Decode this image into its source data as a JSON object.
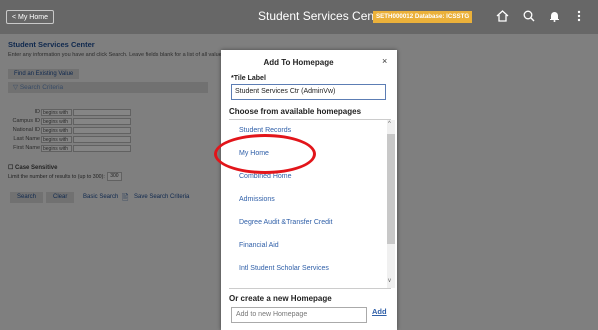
{
  "topbar": {
    "back_label": "< My Home",
    "title": "Student Services Center",
    "db_badge": "SETH000012 Database: ICSSTG"
  },
  "search_page": {
    "title": "Student Services Center",
    "instructions": "Enter any information you have and click Search. Leave fields blank for a list of all values.",
    "find_tab": "Find an Existing Value",
    "criteria_heading": "Search Criteria",
    "fields": [
      {
        "label": "ID",
        "operator": "begins with"
      },
      {
        "label": "Campus ID",
        "operator": "begins with"
      },
      {
        "label": "National ID",
        "operator": "begins with"
      },
      {
        "label": "Last Name",
        "operator": "begins with"
      },
      {
        "label": "First Name",
        "operator": "begins with"
      }
    ],
    "case_sensitive": "Case Sensitive",
    "limit_text": "Limit the number of results to (up to 300):",
    "limit_value": "300",
    "search_button": "Search",
    "clear_button": "Clear",
    "basic_search": "Basic Search",
    "save_criteria": "Save Search Criteria"
  },
  "dialog": {
    "title": "Add To Homepage",
    "close": "×",
    "tile_label_heading": "*Tile Label",
    "tile_label_value": "Student Services Ctr (AdminVw)",
    "choose_heading": "Choose from available homepages",
    "homepages": [
      "Student Records",
      "My Home",
      "Combined Home",
      "Admissions",
      "Degree Audit &Transfer Credit",
      "Financial Aid",
      "Intl Student Scholar Services"
    ],
    "create_heading": "Or create a new Homepage",
    "new_homepage_placeholder": "Add to new Homepage",
    "add_label": "Add"
  },
  "icons": [
    "home-icon",
    "search-icon",
    "bell-icon",
    "more-icon"
  ],
  "colors": {
    "topbar": "#676767",
    "badge": "#ebb13a",
    "link": "#2f5fa8",
    "highlight": "#e2151a"
  }
}
